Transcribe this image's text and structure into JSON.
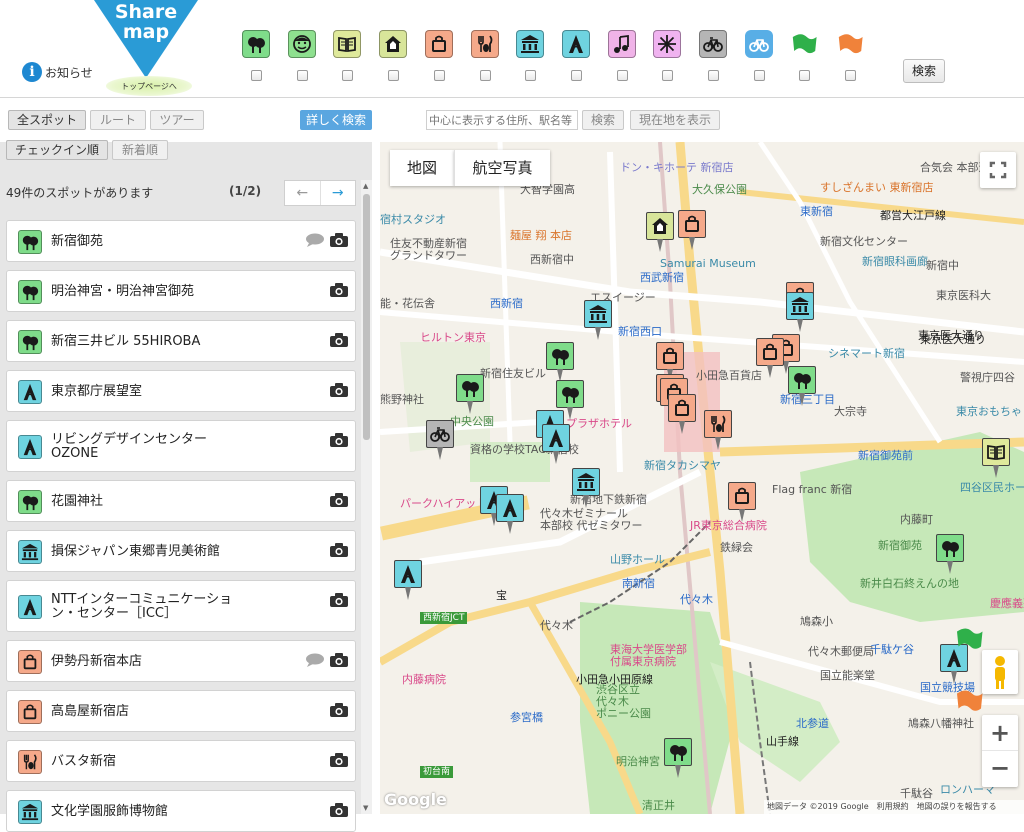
{
  "header": {
    "logo_line1": "Share",
    "logo_line2": "map",
    "toppage_label": "トップページへ",
    "news_label": "お知らせ",
    "search_button": "検索"
  },
  "categories": [
    {
      "name": "park",
      "color": "#7fdc8a",
      "icon": "tree-icon"
    },
    {
      "name": "person",
      "color": "#8ee08f",
      "icon": "face-icon"
    },
    {
      "name": "book",
      "color": "#dfe99b",
      "icon": "book-icon"
    },
    {
      "name": "house",
      "color": "#d8e59a",
      "icon": "house-icon"
    },
    {
      "name": "shopping",
      "color": "#f5a98a",
      "icon": "bag-icon"
    },
    {
      "name": "food",
      "color": "#f5a98a",
      "icon": "cutlery-icon"
    },
    {
      "name": "museum",
      "color": "#6fd3e0",
      "icon": "museum-icon"
    },
    {
      "name": "tower",
      "color": "#6fd3e0",
      "icon": "tower-icon"
    },
    {
      "name": "music",
      "color": "#f0b3e8",
      "icon": "music-icon"
    },
    {
      "name": "sparkle",
      "color": "#f0b3f0",
      "icon": "sparkle-icon"
    },
    {
      "name": "bicycle",
      "color": "#b5b5b5",
      "icon": "bicycle-icon"
    },
    {
      "name": "route",
      "color": "#58aee6",
      "icon": "route-icon"
    },
    {
      "name": "green-flag",
      "color": "#2fb04a",
      "icon": "green-flag-icon"
    },
    {
      "name": "orange-flag",
      "color": "#f0823a",
      "icon": "orange-flag-icon"
    }
  ],
  "toolbar": {
    "all_spots": "全スポット",
    "route": "ルート",
    "tour": "ツアー",
    "advanced_search": "詳しく検索",
    "address_placeholder": "中心に表示する住所、駅名等",
    "search": "検索",
    "current_location": "現在地を表示",
    "sort_checkin": "チェックイン順",
    "sort_new": "新着順"
  },
  "list": {
    "count_text": "49件のスポットがあります",
    "page_indicator": "(1/2)",
    "prev": "←",
    "next": "→",
    "spots": [
      {
        "name": "新宿御苑",
        "icon": "tree-icon",
        "color": "#7fdc8a",
        "comment": true
      },
      {
        "name": "明治神宮・明治神宮御苑",
        "icon": "tree-icon",
        "color": "#7fdc8a",
        "comment": false
      },
      {
        "name": "新宿三井ビル 55HIROBA",
        "icon": "tree-icon",
        "color": "#7fdc8a",
        "comment": false
      },
      {
        "name": "東京都庁展望室",
        "icon": "tower-icon",
        "color": "#6fd3e0",
        "comment": false
      },
      {
        "name": "リビングデザインセンター\nOZONE",
        "icon": "tower-icon",
        "color": "#6fd3e0",
        "comment": false
      },
      {
        "name": "花園神社",
        "icon": "tree-icon",
        "color": "#7fdc8a",
        "comment": false
      },
      {
        "name": "損保ジャパン東郷青児美術館",
        "icon": "museum-icon",
        "color": "#6fd3e0",
        "comment": false
      },
      {
        "name": "NTTインターコミュニケーショ\nン・センター［ICC］",
        "icon": "tower-icon",
        "color": "#6fd3e0",
        "comment": false
      },
      {
        "name": "伊勢丹新宿本店",
        "icon": "bag-icon",
        "color": "#f5a98a",
        "comment": true
      },
      {
        "name": "高島屋新宿店",
        "icon": "bag-icon",
        "color": "#f5a98a",
        "comment": false
      },
      {
        "name": "バスタ新宿",
        "icon": "cutlery-icon",
        "color": "#f5a98a",
        "comment": false
      },
      {
        "name": "文化学園服飾博物館",
        "icon": "museum-icon",
        "color": "#6fd3e0",
        "comment": false
      }
    ]
  },
  "map": {
    "type_map": "地図",
    "type_aerial": "航空写真",
    "zoom_in": "+",
    "zoom_out": "−",
    "attribution": "地図データ ©2019 Google　利用規約　地図の誤りを報告する",
    "google": "Google",
    "labels": [
      {
        "t": "ドン・キホーテ 新宿店",
        "c": "#7a7acc"
      },
      {
        "t": "合気会 本部道場",
        "c": "#555"
      },
      {
        "t": "大智学園高",
        "c": "#555"
      },
      {
        "t": "大久保公園",
        "c": "#4a8a4a"
      },
      {
        "t": "すしざんまい 東新宿店",
        "c": "#d9732a"
      },
      {
        "t": "宿村スタジオ",
        "c": "#3a8aa8"
      },
      {
        "t": "麺屋 翔 本店",
        "c": "#d9732a"
      },
      {
        "t": "東新宿",
        "c": "#2a6ac8"
      },
      {
        "t": "都営大江戸線",
        "c": "#222"
      },
      {
        "t": "住友不動産新宿\nグランドタワー",
        "c": "#555"
      },
      {
        "t": "西新宿中",
        "c": "#555"
      },
      {
        "t": "Samurai Museum",
        "c": "#3a8aa8"
      },
      {
        "t": "新宿文化センター",
        "c": "#555"
      },
      {
        "t": "新宿眼科画廊",
        "c": "#3a8aa8"
      },
      {
        "t": "新宿中",
        "c": "#555"
      },
      {
        "t": "西武新宿",
        "c": "#2a6ac8"
      },
      {
        "t": "能・花伝舎",
        "c": "#555"
      },
      {
        "t": "西新宿",
        "c": "#2a6ac8"
      },
      {
        "t": "エスイージー",
        "c": "#555"
      },
      {
        "t": "東京医科大",
        "c": "#555"
      },
      {
        "t": "ヒルトン東京",
        "c": "#d94a8a"
      },
      {
        "t": "新宿西口",
        "c": "#2a6ac8"
      },
      {
        "t": "シネマート新宿",
        "c": "#3a8aa8"
      },
      {
        "t": "東京医大通り",
        "c": "#222"
      },
      {
        "t": "新宿住友ビル",
        "c": "#555"
      },
      {
        "t": "小田急百貨店",
        "c": "#555"
      },
      {
        "t": "警視庁四谷",
        "c": "#555"
      },
      {
        "t": "熊野神社",
        "c": "#555"
      },
      {
        "t": "中央公園",
        "c": "#4a8a4a"
      },
      {
        "t": "プラザホテル",
        "c": "#d94a8a"
      },
      {
        "t": "新宿三丁目",
        "c": "#2a6ac8"
      },
      {
        "t": "大宗寺",
        "c": "#555"
      },
      {
        "t": "東京おもちゃ",
        "c": "#3a8aa8"
      },
      {
        "t": "資格の学校TAC新宿校",
        "c": "#555"
      },
      {
        "t": "新宿タカシマヤ",
        "c": "#3a8aa8"
      },
      {
        "t": "新宿御苑前",
        "c": "#2a6ac8"
      },
      {
        "t": "四谷区民ホール",
        "c": "#3a8aa8"
      },
      {
        "t": "パークハイアット",
        "c": "#d94a8a"
      },
      {
        "t": "新宿地下鉄新宿",
        "c": "#555"
      },
      {
        "t": "Flag franc 新宿",
        "c": "#555"
      },
      {
        "t": "代々木ゼミナール\n本部校 代ゼミタワー",
        "c": "#555"
      },
      {
        "t": "JR東京総合病院",
        "c": "#d94a8a"
      },
      {
        "t": "内藤町",
        "c": "#555"
      },
      {
        "t": "新宿御苑",
        "c": "#4a8a4a"
      },
      {
        "t": "鉄緑会",
        "c": "#555"
      },
      {
        "t": "山野ホール",
        "c": "#3a8aa8"
      },
      {
        "t": "南新宿",
        "c": "#2a6ac8"
      },
      {
        "t": "新井白石終えんの地",
        "c": "#4a8a4a"
      },
      {
        "t": "代々木",
        "c": "#2a6ac8"
      },
      {
        "t": "西新宿JCT",
        "c": "#fff"
      },
      {
        "t": "代々木",
        "c": "#555"
      },
      {
        "t": "鳩森小",
        "c": "#555"
      },
      {
        "t": "慶應義塾大",
        "c": "#d94a8a"
      },
      {
        "t": "東海大学医学部\n付属東京病院",
        "c": "#d94a8a"
      },
      {
        "t": "代々木郵便局",
        "c": "#555"
      },
      {
        "t": "千駄ケ谷",
        "c": "#2a6ac8"
      },
      {
        "t": "内藤病院",
        "c": "#d94a8a"
      },
      {
        "t": "渋谷区立\n代々木\nポニー公園",
        "c": "#4a8a4a"
      },
      {
        "t": "国立能楽堂",
        "c": "#555"
      },
      {
        "t": "国立競技場",
        "c": "#2a6ac8"
      },
      {
        "t": "参宮橋",
        "c": "#2a6ac8"
      },
      {
        "t": "北参道",
        "c": "#2a6ac8"
      },
      {
        "t": "鳩森八幡神社",
        "c": "#555"
      },
      {
        "t": "初台南",
        "c": "#fff"
      },
      {
        "t": "明治神宮",
        "c": "#4a8a4a"
      },
      {
        "t": "千駄谷",
        "c": "#555"
      },
      {
        "t": "清正井",
        "c": "#4a8a4a"
      },
      {
        "t": "ロンハーマ",
        "c": "#3a8aa8"
      },
      {
        "t": "小田急小田原線",
        "c": "#222"
      },
      {
        "t": "山手線",
        "c": "#222"
      },
      {
        "t": "東京医大通り",
        "c": "#222"
      },
      {
        "t": "宝",
        "c": "#222"
      }
    ]
  }
}
